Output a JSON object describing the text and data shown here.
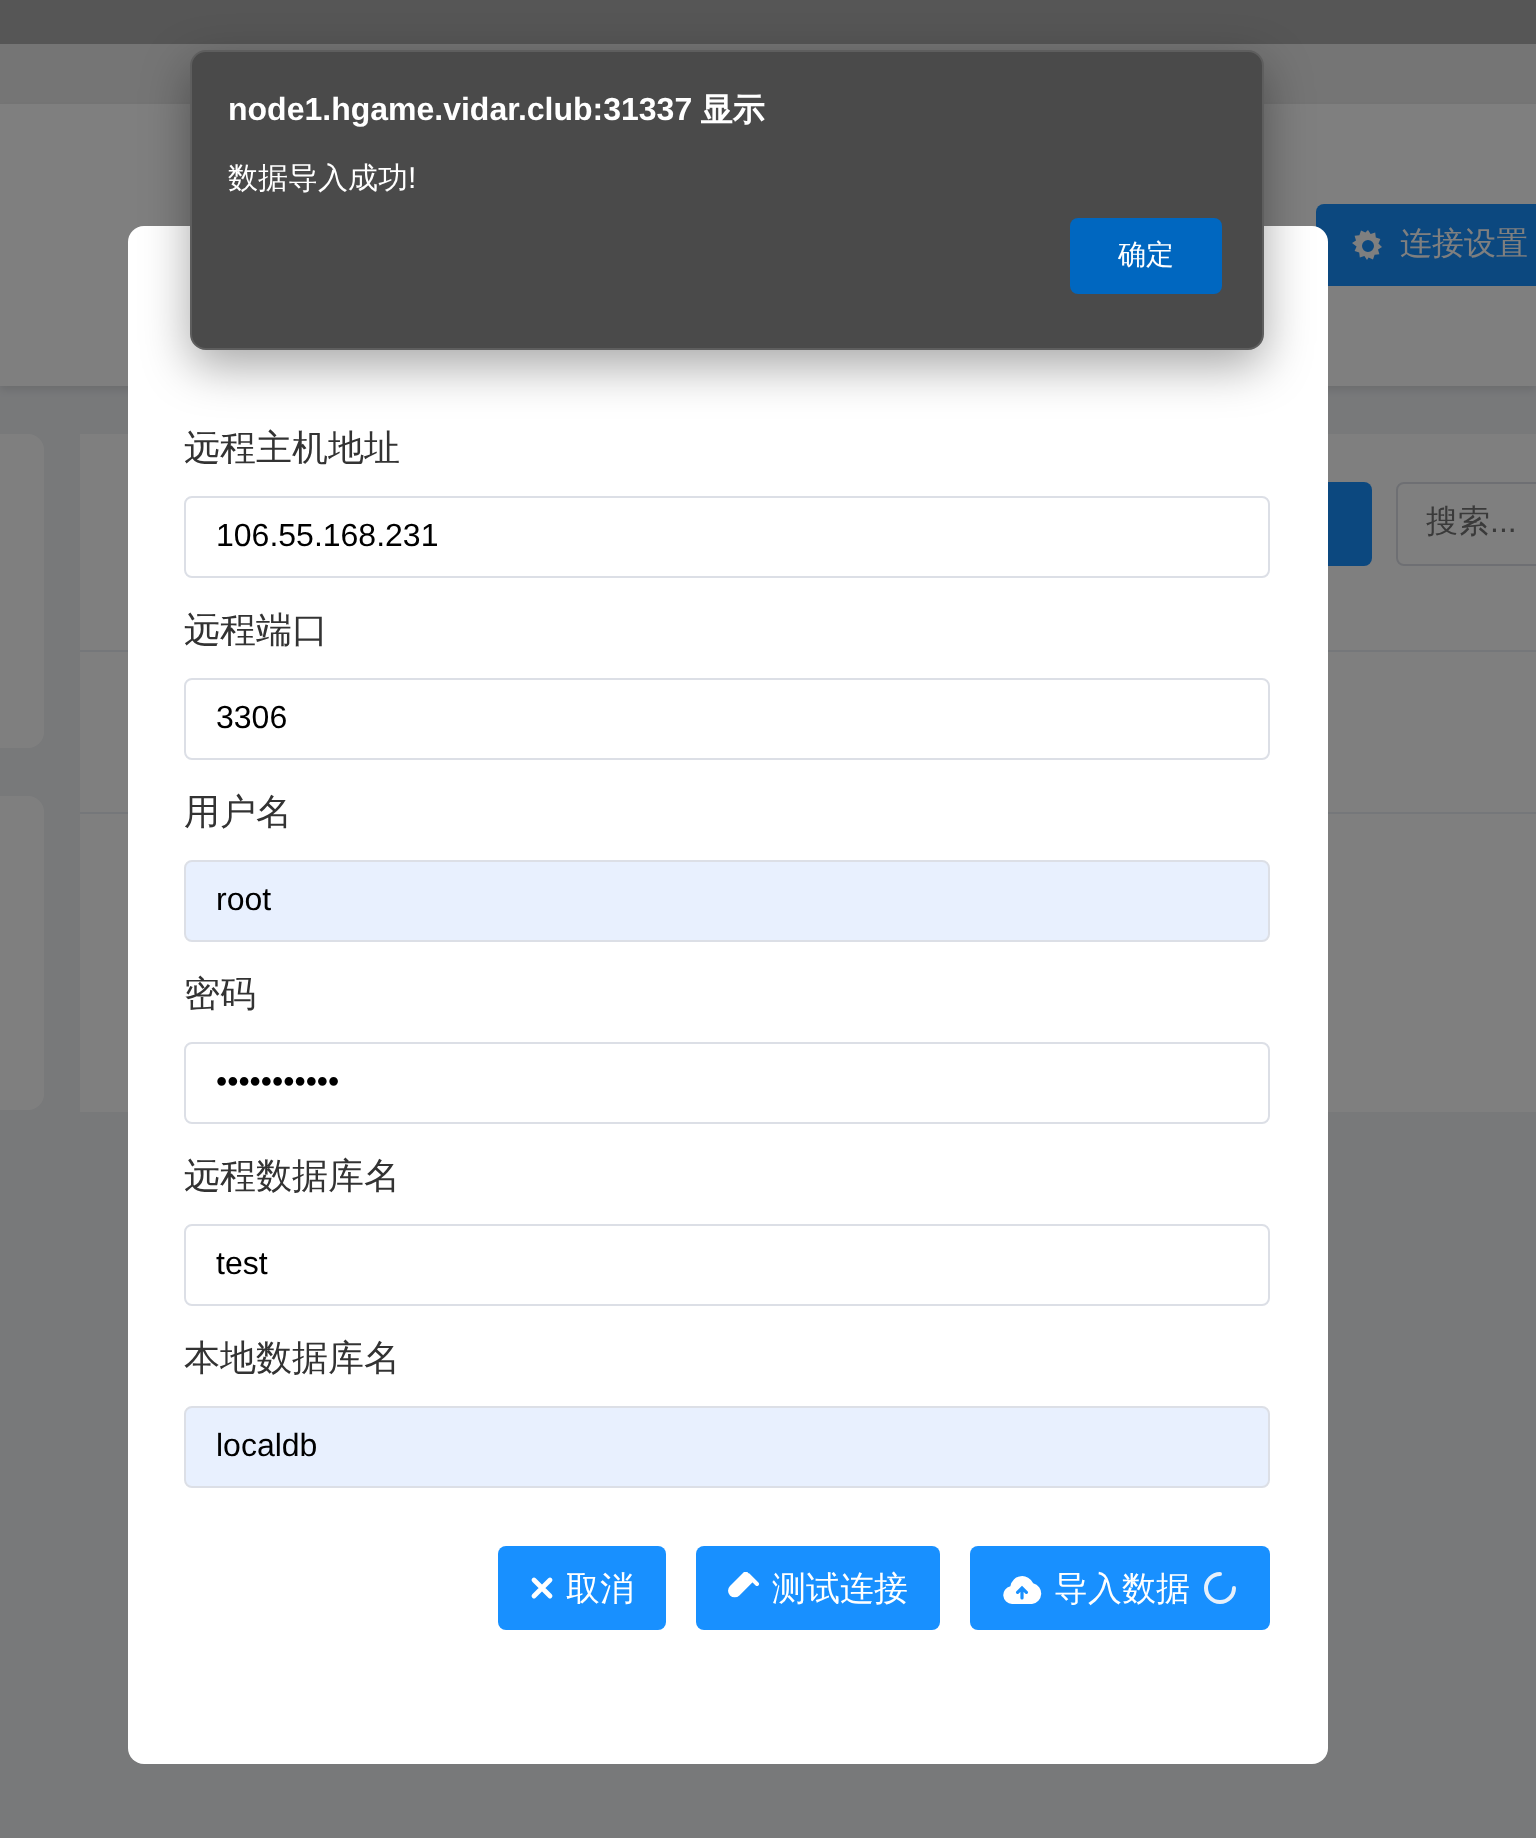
{
  "page": {
    "settings_button": "连接设置",
    "search": {
      "placeholder": "搜索..."
    }
  },
  "modal": {
    "fields": [
      {
        "label": "远程主机地址",
        "value": "106.55.168.231",
        "autofilled": false
      },
      {
        "label": "远程端口",
        "value": "3306",
        "autofilled": false
      },
      {
        "label": "用户名",
        "value": "root",
        "autofilled": true
      },
      {
        "label": "密码",
        "value": "•••••••••••",
        "autofilled": false
      },
      {
        "label": "远程数据库名",
        "value": "test",
        "autofilled": false
      },
      {
        "label": "本地数据库名",
        "value": "localdb",
        "autofilled": true
      }
    ],
    "buttons": [
      {
        "kind": "cancel",
        "label": "取消",
        "loading": false
      },
      {
        "kind": "test",
        "label": "测试连接",
        "loading": false
      },
      {
        "kind": "import",
        "label": "导入数据",
        "loading": true
      }
    ]
  },
  "alert": {
    "title": "node1.hgame.vidar.club:31337 显示",
    "message": "数据导入成功!",
    "button": "确定"
  }
}
